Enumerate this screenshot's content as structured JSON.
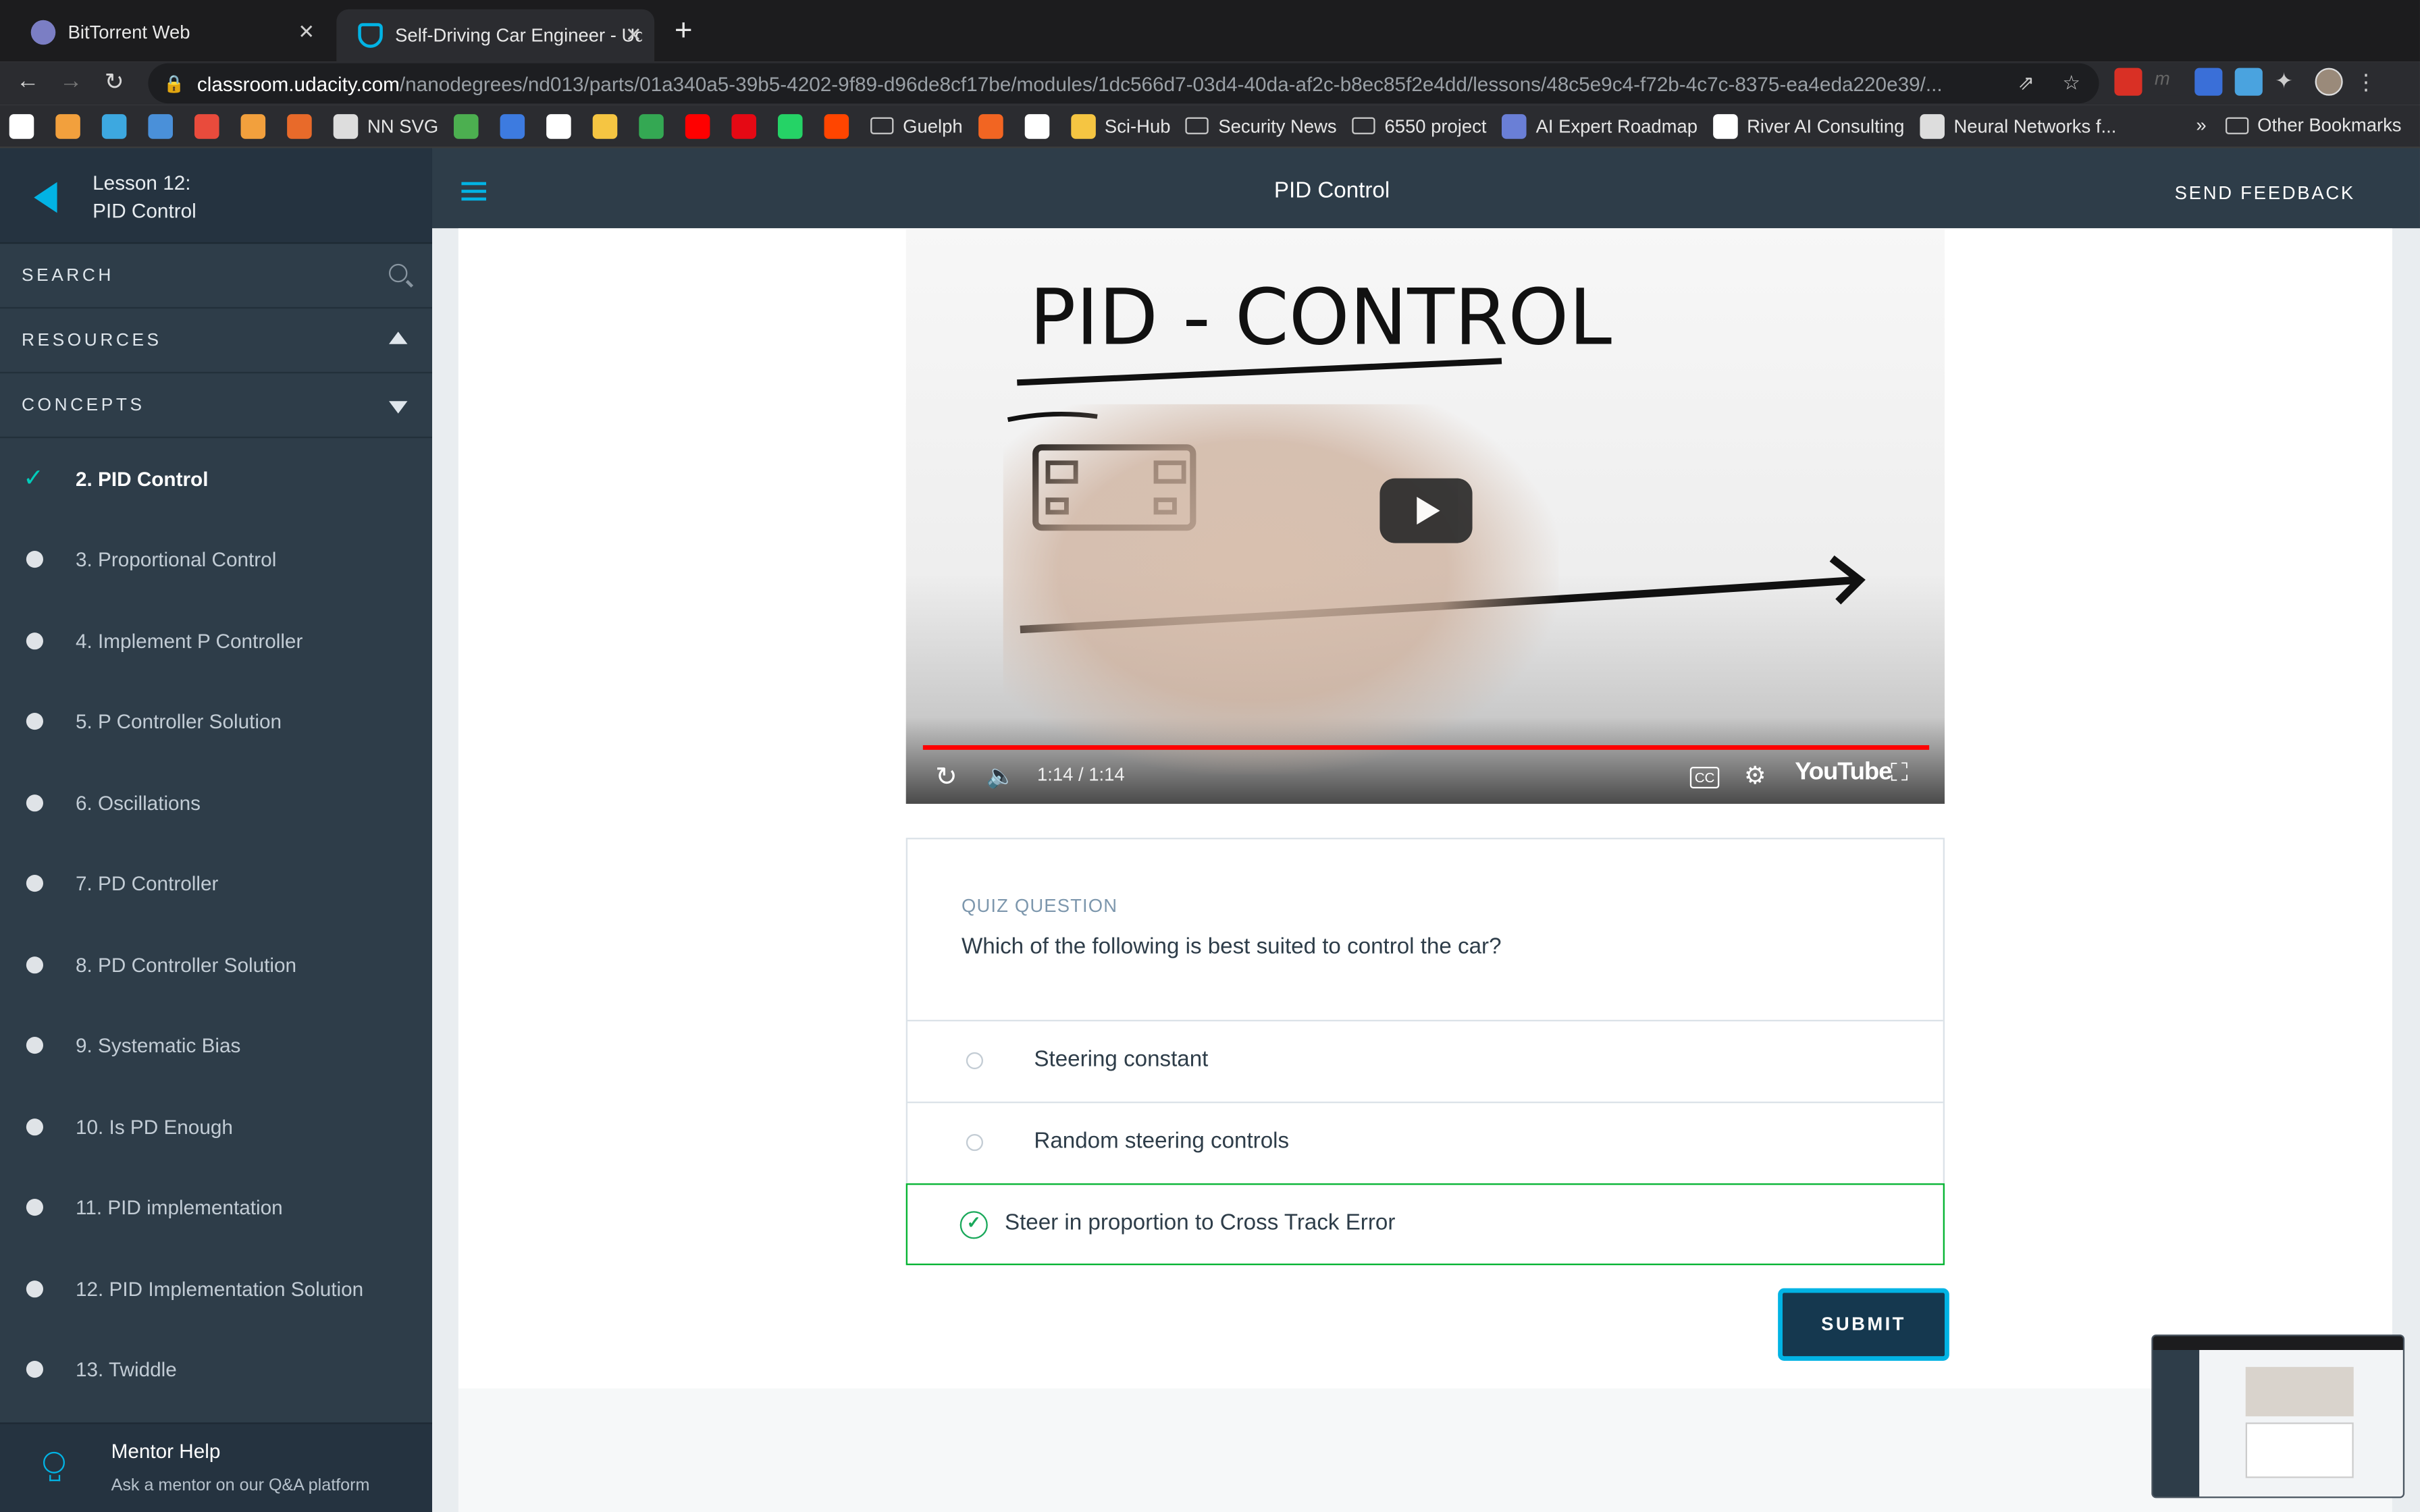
{
  "browser": {
    "tabs": [
      {
        "title": "BitTorrent Web",
        "favicon_color": "#7b7ec4"
      },
      {
        "title": "Self-Driving Car Engineer - Uda",
        "favicon_color": "#02b3e4"
      }
    ],
    "url_host": "classroom.udacity.com",
    "url_path": "/nanodegrees/nd013/parts/01a340a5-39b5-4202-9f89-d96de8cf17be/modules/1dc566d7-03d4-40da-af2c-b8ec85f2e4dd/lessons/48c5e9c4-f72b-4c7c-8375-ea4eda220e39/...",
    "bookmarks": [
      {
        "label": "",
        "color": "#ffffff"
      },
      {
        "label": "",
        "color": "#f2a03d"
      },
      {
        "label": "",
        "color": "#3da8e0"
      },
      {
        "label": "",
        "color": "#4a90d9"
      },
      {
        "label": "",
        "color": "#e94b3c"
      },
      {
        "label": "",
        "color": "#f2a03d"
      },
      {
        "label": "",
        "color": "#e86a2a"
      },
      {
        "label": "NN SVG",
        "color": "#dddddd"
      },
      {
        "label": "",
        "color": "#4caf50"
      },
      {
        "label": "",
        "color": "#3d7be0"
      },
      {
        "label": "",
        "color": "#ffffff"
      },
      {
        "label": "",
        "color": "#f5c542"
      },
      {
        "label": "",
        "color": "#34a853"
      },
      {
        "label": "",
        "color": "#ff0000"
      },
      {
        "label": "",
        "color": "#e50914"
      },
      {
        "label": "",
        "color": "#25d366"
      },
      {
        "label": "",
        "color": "#ff4500"
      },
      {
        "label": "Guelph",
        "folder": true
      },
      {
        "label": "",
        "color": "#f26522"
      },
      {
        "label": "",
        "color": "#ffffff"
      },
      {
        "label": "Sci-Hub",
        "color": "#f5c542"
      },
      {
        "label": "Security News",
        "folder": true
      },
      {
        "label": "6550 project",
        "folder": true
      },
      {
        "label": "AI Expert Roadmap",
        "color": "#6a7fd6"
      },
      {
        "label": "River AI Consulting",
        "color": "#ffffff"
      },
      {
        "label": "Neural Networks f...",
        "color": "#dddddd"
      }
    ],
    "more_bookmarks": "»",
    "other_bookmarks": "Other Bookmarks"
  },
  "sidebar": {
    "lesson_line1": "Lesson 12:",
    "lesson_line2": "PID Control",
    "search_label": "SEARCH",
    "resources_label": "RESOURCES",
    "concepts_label": "CONCEPTS",
    "concepts": [
      {
        "label": "2. PID Control",
        "active": true
      },
      {
        "label": "3. Proportional Control"
      },
      {
        "label": "4. Implement P Controller"
      },
      {
        "label": "5. P Controller Solution"
      },
      {
        "label": "6. Oscillations"
      },
      {
        "label": "7. PD Controller"
      },
      {
        "label": "8. PD Controller Solution"
      },
      {
        "label": "9. Systematic Bias"
      },
      {
        "label": "10. Is PD Enough"
      },
      {
        "label": "11. PID implementation"
      },
      {
        "label": "12. PID Implementation Solution"
      },
      {
        "label": "13. Twiddle"
      }
    ],
    "mentor_title": "Mentor Help",
    "mentor_sub": "Ask a mentor on our Q&A platform"
  },
  "header": {
    "title": "PID Control",
    "feedback": "SEND FEEDBACK"
  },
  "video": {
    "time": "1:14 / 1:14",
    "watched_fraction": 1.0,
    "brand": "YouTube",
    "whiteboard_title": "PID - CONTROL"
  },
  "quiz": {
    "label": "QUIZ QUESTION",
    "question": "Which of the following is best suited to control the car?",
    "options": [
      {
        "text": "Steering constant"
      },
      {
        "text": "Random steering controls"
      },
      {
        "text": "Steer in proportion to Cross Track Error",
        "correct": true
      }
    ],
    "submit": "SUBMIT"
  },
  "colors": {
    "accent": "#02b3e4",
    "sidebar": "#2e3d49",
    "correct": "#02b32f"
  }
}
